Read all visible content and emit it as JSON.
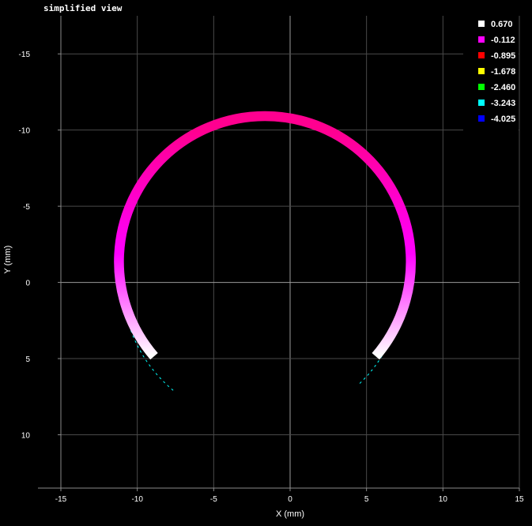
{
  "view": {
    "title": "simplified view"
  },
  "chart_data": {
    "type": "scatter",
    "title": "",
    "xlabel": "X (mm)",
    "ylabel": "Y (mm)",
    "xlim": [
      -16.5,
      15
    ],
    "ylim": [
      -17.5,
      13.5
    ],
    "y_inverted": true,
    "x_ticks": [
      -15,
      -10,
      -5,
      0,
      5,
      10,
      15
    ],
    "y_ticks": [
      -15,
      -10,
      -5,
      0,
      5,
      10
    ],
    "x_tick_labels": [
      "-15",
      "-10",
      "-5",
      "0",
      "5",
      "10",
      "15"
    ],
    "y_tick_labels": [
      "-15",
      "-10",
      "-5",
      "0",
      "5",
      "10"
    ],
    "grid": true,
    "legend_position": "top-right",
    "legend": [
      {
        "label": "0.670",
        "color": "#ffffff"
      },
      {
        "label": "-0.112",
        "color": "#ff00ff"
      },
      {
        "label": "-0.895",
        "color": "#ff0000"
      },
      {
        "label": "-1.678",
        "color": "#ffff00"
      },
      {
        "label": "-2.460",
        "color": "#00ff00"
      },
      {
        "label": "-3.243",
        "color": "#00ffff"
      },
      {
        "label": "-4.025",
        "color": "#0000ff"
      }
    ],
    "arc": {
      "center": [
        -1.8,
        0
      ],
      "radius": 9.55,
      "band_width": 0.65,
      "start_point": [
        -8.9,
        4.85
      ],
      "end_point": [
        5.6,
        4.85
      ],
      "color_top": "#ff0090",
      "color_sides": "#ff00ff",
      "color_ends": "#ffffff",
      "edge_color": "#00ffff"
    }
  }
}
